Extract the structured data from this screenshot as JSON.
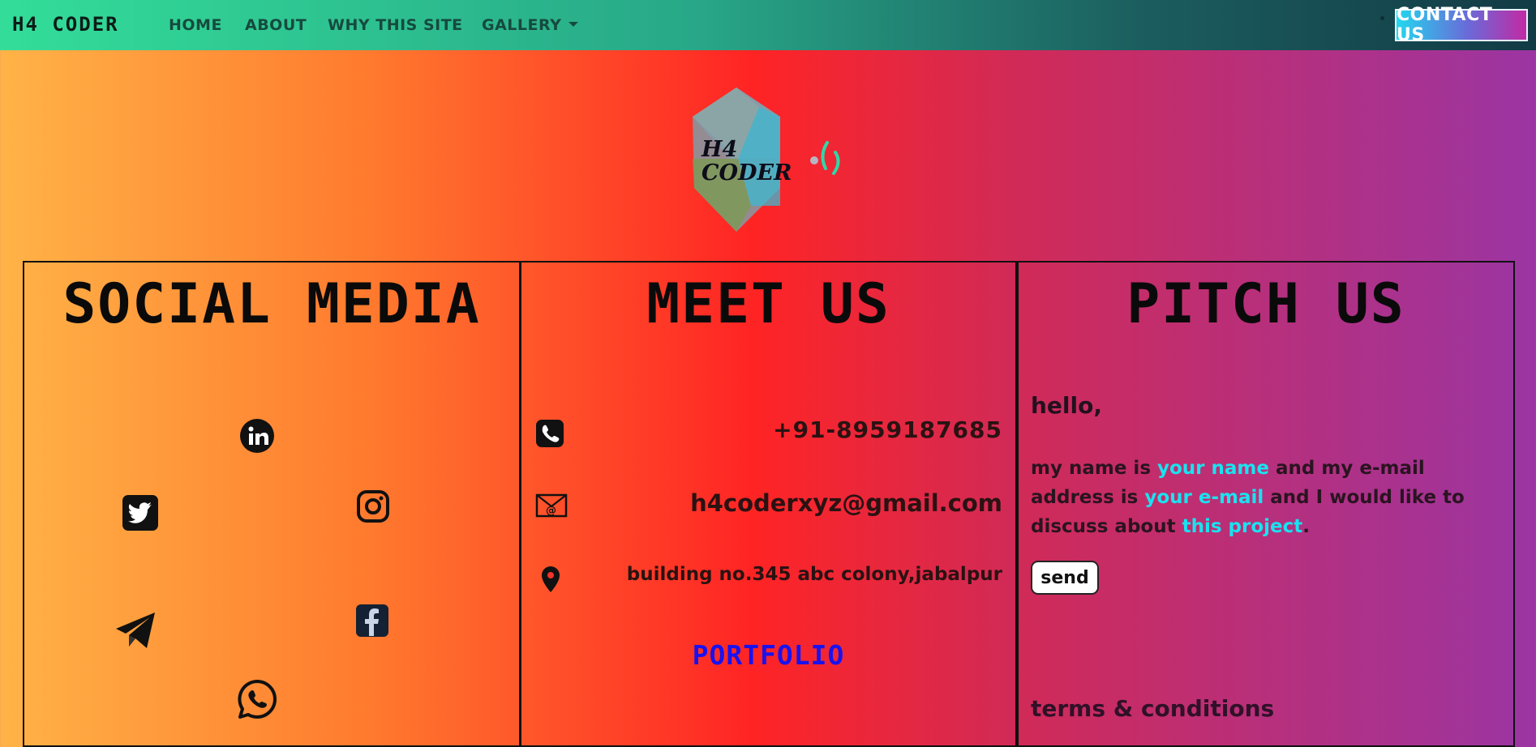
{
  "navbar": {
    "brand": "H4 CODER",
    "items": [
      {
        "label": "HOME"
      },
      {
        "label": "ABOUT"
      },
      {
        "label": "WHY THIS SITE"
      },
      {
        "label": "GALLERY"
      }
    ],
    "contact_button": "CONTACT US"
  },
  "logo": {
    "line1": "H4",
    "line2": "CODER"
  },
  "social": {
    "title": "SOCIAL MEDIA",
    "icons": [
      "linkedin-icon",
      "twitter-icon",
      "instagram-icon",
      "telegram-icon",
      "facebook-icon",
      "whatsapp-icon"
    ]
  },
  "meet": {
    "title": "MEET US",
    "phone": "+91-8959187685",
    "email": "h4coderxyz@gmail.com",
    "address": "building no.345 abc colony,jabalpur",
    "portfolio": "PORTFOLIO"
  },
  "pitch": {
    "title": "PITCH US",
    "greeting": "hello,",
    "text1": "my name is ",
    "name_placeholder": "your name",
    "text2": " and my e-mail address is ",
    "email_placeholder": "your e-mail",
    "text3": " and I would like to discuss about ",
    "project_placeholder": "this project",
    "text4": ".",
    "send": "send",
    "terms": "terms & conditions"
  },
  "colors": {
    "highlight": "#19e3f0",
    "portfolio": "#1a12ee"
  }
}
